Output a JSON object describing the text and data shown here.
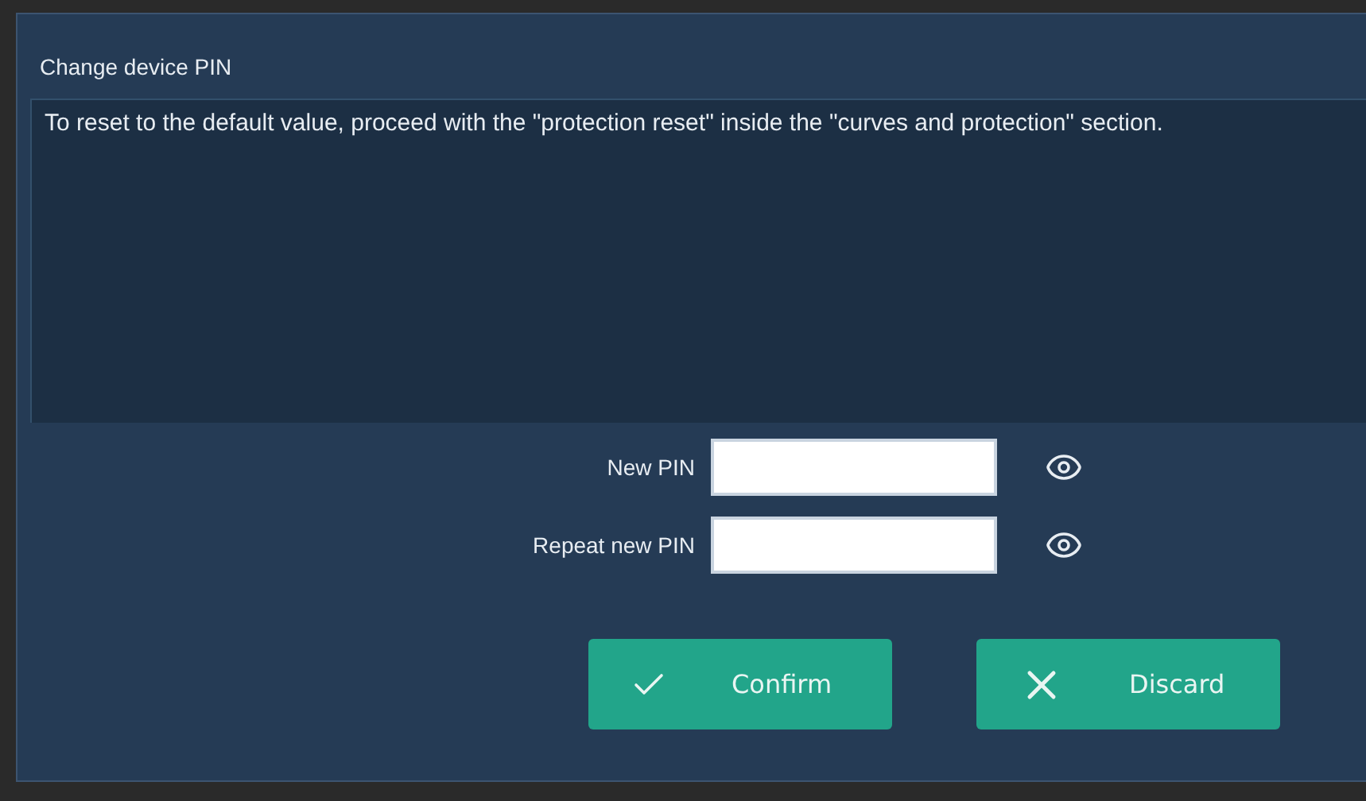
{
  "window": {
    "title": "Change device PIN"
  },
  "message": "To reset to the default value, proceed with the \"protection reset\" inside the \"curves and protection\" section.",
  "fields": [
    {
      "label": "New PIN"
    },
    {
      "label": "Repeat new PIN"
    }
  ],
  "buttons": [
    {
      "label": "Confirm",
      "kind": "confirm"
    },
    {
      "label": "Discard",
      "kind": "discard"
    }
  ]
}
